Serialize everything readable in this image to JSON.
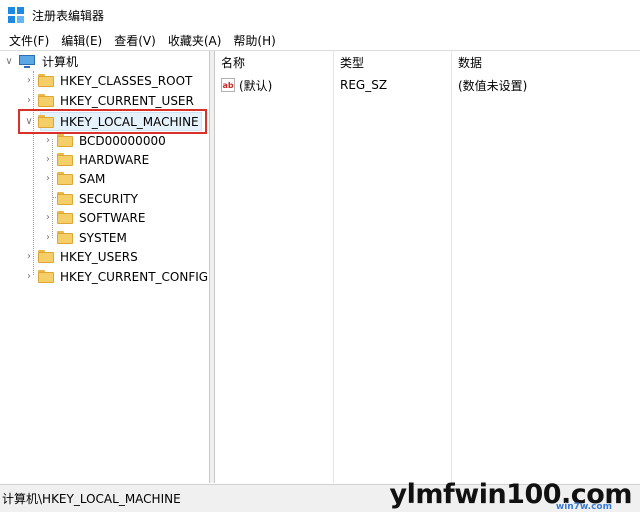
{
  "window": {
    "title": "注册表编辑器"
  },
  "menu": [
    "文件(F)",
    "编辑(E)",
    "查看(V)",
    "收藏夹(A)",
    "帮助(H)"
  ],
  "tree": {
    "root": "计算机",
    "hives": [
      {
        "label": "HKEY_CLASSES_ROOT"
      },
      {
        "label": "HKEY_CURRENT_USER"
      },
      {
        "label": "HKEY_LOCAL_MACHINE",
        "selected": true,
        "expanded": true,
        "children": [
          "BCD00000000",
          "HARDWARE",
          "SAM",
          "SECURITY",
          "SOFTWARE",
          "SYSTEM"
        ]
      },
      {
        "label": "HKEY_USERS"
      },
      {
        "label": "HKEY_CURRENT_CONFIG"
      }
    ]
  },
  "list": {
    "columns": [
      "名称",
      "类型",
      "数据"
    ],
    "rows": [
      {
        "name": "(默认)",
        "type": "REG_SZ",
        "data": "(数值未设置)",
        "icon": "ab-string-icon"
      }
    ]
  },
  "status": {
    "path": "计算机\\HKEY_LOCAL_MACHINE"
  },
  "watermark": {
    "text": "ylmfwin100.com",
    "sub": "win7w.com"
  },
  "colors": {
    "highlight_border": "#d9302a",
    "selection_bg": "#e5f1fb",
    "folder": "#f6ce68"
  }
}
